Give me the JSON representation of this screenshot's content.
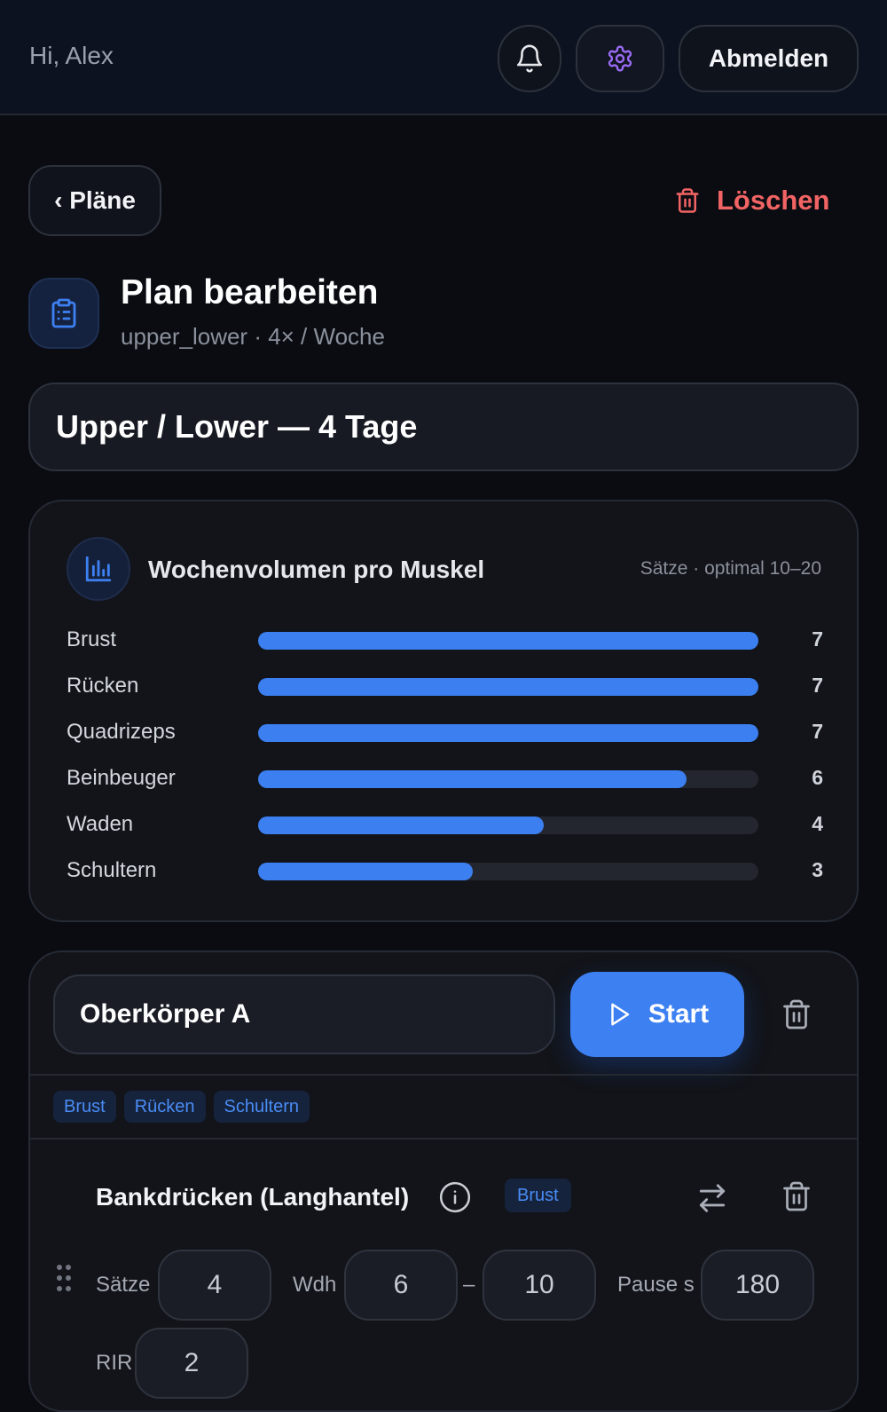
{
  "header": {
    "greeting": "Hi, Alex",
    "logout_label": "Abmelden"
  },
  "nav": {
    "back_label": "‹ Pläne",
    "delete_label": "Löschen"
  },
  "plan": {
    "title": "Plan bearbeiten",
    "subtitle": "upper_lower · 4× / Woche",
    "name_value": "Upper / Lower — 4 Tage"
  },
  "volume": {
    "title": "Wochenvolumen pro Muskel",
    "hint": "Sätze · optimal 10–20",
    "max_sets": 7,
    "rows": [
      {
        "label": "Brust",
        "sets": 7
      },
      {
        "label": "Rücken",
        "sets": 7
      },
      {
        "label": "Quadrizeps",
        "sets": 7
      },
      {
        "label": "Beinbeuger",
        "sets": 6
      },
      {
        "label": "Waden",
        "sets": 4
      },
      {
        "label": "Schultern",
        "sets": 3
      }
    ]
  },
  "day": {
    "name_value": "Oberkörper A",
    "start_label": "Start",
    "tags": [
      "Brust",
      "Rücken",
      "Schultern"
    ],
    "exercise": {
      "name": "Bankdrücken (Langhantel)",
      "muscle_tag": "Brust",
      "sets_label": "Sätze",
      "sets_value": "4",
      "reps_label": "Wdh",
      "reps_min": "6",
      "reps_sep": "–",
      "reps_max": "10",
      "rest_label": "Pause s",
      "rest_value": "180",
      "rir_label": "RIR",
      "rir_value": "2"
    }
  },
  "colors": {
    "accent": "#3d80f2",
    "danger": "#f26464",
    "background": "#0a0c12"
  }
}
